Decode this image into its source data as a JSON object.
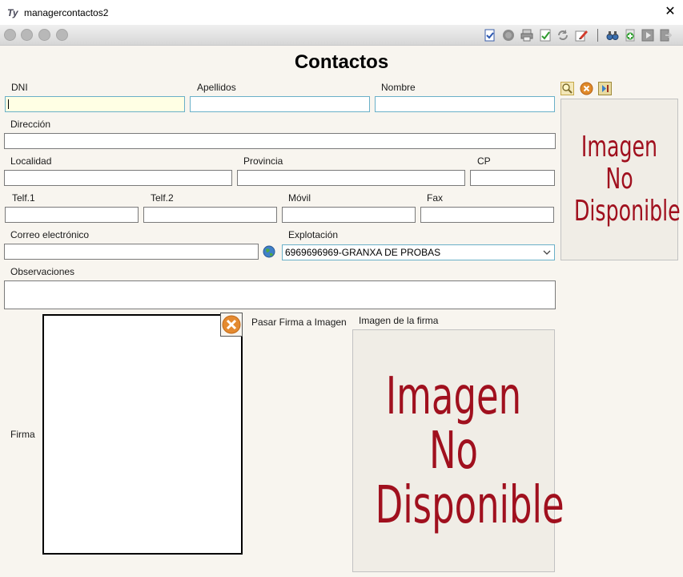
{
  "window": {
    "title": "managercontactos2",
    "app_icon": "Ty"
  },
  "toolbar": {
    "nav_buttons": [
      "first-record",
      "previous-record",
      "next-record",
      "last-record"
    ],
    "icons": [
      "validate-icon",
      "circle-icon",
      "print-icon",
      "checklist-icon",
      "refresh-icon",
      "edit-icon",
      "binoculars-icon",
      "new-record-icon",
      "play-icon",
      "exit-icon"
    ]
  },
  "form": {
    "title": "Contactos",
    "labels": {
      "dni": "DNI",
      "apellidos": "Apellidos",
      "nombre": "Nombre",
      "direccion": "Dirección",
      "localidad": "Localidad",
      "provincia": "Provincia",
      "cp": "CP",
      "telf1": "Telf.1",
      "telf2": "Telf.2",
      "movil": "Móvil",
      "fax": "Fax",
      "correo": "Correo electrónico",
      "explotacion": "Explotación",
      "observaciones": "Observaciones",
      "firma": "Firma",
      "pasar_firma": "Pasar Firma a Imagen",
      "imagen_firma": "Imagen de la firma"
    },
    "values": {
      "dni": "",
      "apellidos": "",
      "nombre": "",
      "direccion": "",
      "localidad": "",
      "provincia": "",
      "cp": "",
      "telf1": "",
      "telf2": "",
      "movil": "",
      "fax": "",
      "correo": "",
      "observaciones": "",
      "explotacion": "6969696969-GRANXA DE PROBAS"
    },
    "no_image": {
      "line1": "Imagen",
      "line2": "No",
      "line3": "Disponible"
    }
  }
}
